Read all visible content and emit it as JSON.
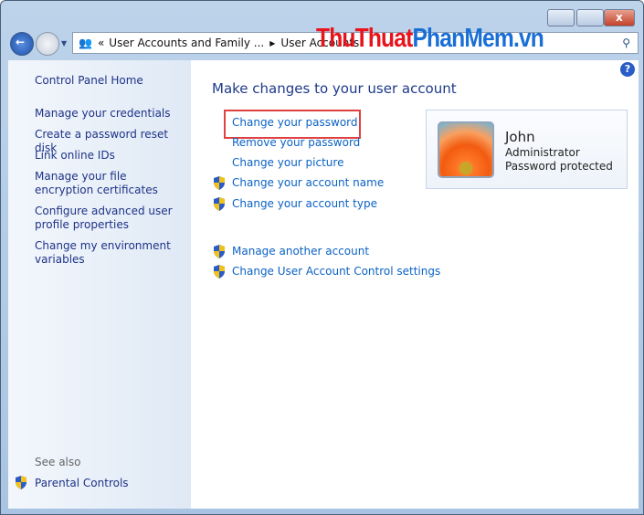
{
  "window": {
    "breadcrumb": [
      "User Accounts and Family ...",
      "User Accounts"
    ],
    "watermark": {
      "part1": "ThuThuat",
      "part2": "PhanMem.vn",
      "color1": "#e8141c",
      "color2": "#1a6fd6"
    }
  },
  "sidebar": {
    "home": "Control Panel Home",
    "items": [
      "Manage your credentials",
      "Create a password reset disk",
      "Link online IDs",
      "Manage your file encryption certificates",
      "Configure advanced user profile properties",
      "Change my environment variables"
    ],
    "see_also": "See also",
    "parental": "Parental Controls"
  },
  "main": {
    "title": "Make changes to your user account",
    "links": [
      "Change your password",
      "Remove your password",
      "Change your picture",
      "Change your account name",
      "Change your account type"
    ],
    "links2": [
      "Manage another account",
      "Change User Account Control settings"
    ]
  },
  "account": {
    "name": "John",
    "role": "Administrator",
    "status": "Password protected"
  }
}
